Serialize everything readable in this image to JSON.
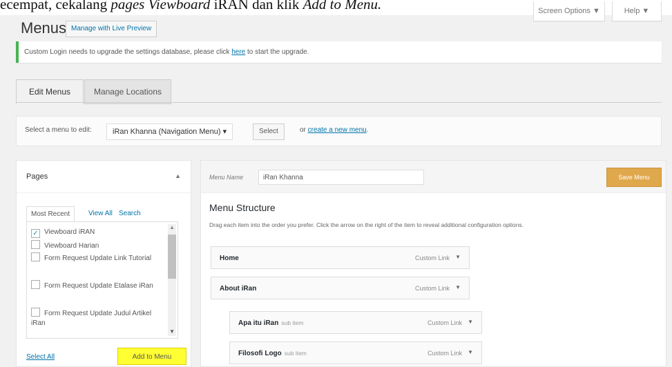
{
  "caption": {
    "pre": "ecempat, cekalang ",
    "italic1": "pages Viewboard",
    "mid": " iRAN dan klik ",
    "italic2": "Add to Menu."
  },
  "header": {
    "title": "Menus",
    "live_preview": "Manage with Live Preview",
    "screen_options": "Screen Options ▼",
    "help": "Help ▼"
  },
  "notice": {
    "before": "Custom Login needs to upgrade the settings database, please click ",
    "link": "here",
    "after": " to start the upgrade."
  },
  "tabs": [
    {
      "label": "Edit Menus"
    },
    {
      "label": "Manage Locations"
    }
  ],
  "menu_select": {
    "label": "Select a menu to edit:",
    "value": "iRan Khanna (Navigation Menu) ▾",
    "select_btn": "Select",
    "or": "or ",
    "create_link": "create a new menu",
    "period": "."
  },
  "pages_box": {
    "title": "Pages",
    "collapse_icon": "▲",
    "subtabs": [
      "Most Recent",
      "View All",
      "Search"
    ],
    "items": [
      {
        "label": "Viewboard iRAN",
        "checked": true
      },
      {
        "label": "Viewboard Harian",
        "checked": false
      },
      {
        "label": "Form Request Update Link Tutorial",
        "checked": false
      },
      {
        "label": "Form Request Update Etalase iRan",
        "checked": false
      },
      {
        "label": "Form Request Update Judul Artikel iRan",
        "checked": false
      }
    ],
    "select_all": "Select All",
    "add_to_menu": "Add to Menu"
  },
  "menu_editor": {
    "name_label": "Menu Name",
    "name_value": "iRan Khanna",
    "save_label": "Save Menu",
    "structure_title": "Menu Structure",
    "structure_desc": "Drag each item into the order you prefer. Click the arrow on the right of the item to reveal additional configuration options.",
    "items": [
      {
        "name": "Home",
        "sub": "",
        "type": "Custom Link"
      },
      {
        "name": "About iRan",
        "sub": "",
        "type": "Custom Link"
      },
      {
        "name": "Apa itu iRan",
        "sub": "sub item",
        "type": "Custom Link"
      },
      {
        "name": "Filosofi Logo",
        "sub": "sub item",
        "type": "Custom Link"
      }
    ]
  },
  "colors": {
    "accent": "#0073aa",
    "save": "#e0a84c",
    "notice": "#46b450",
    "highlight": "#ffff33"
  }
}
